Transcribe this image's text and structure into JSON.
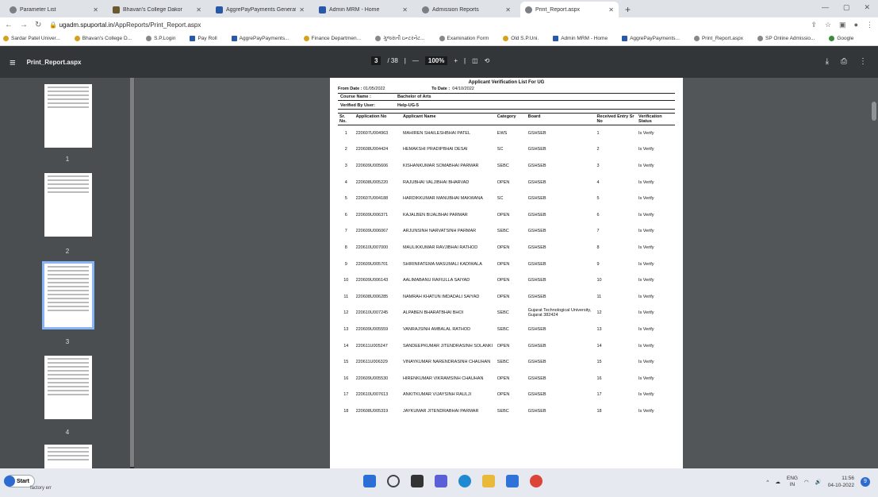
{
  "browser": {
    "tabs": [
      {
        "label": "Parameter List",
        "active": false
      },
      {
        "label": "Bhavan's College Dakor",
        "active": false
      },
      {
        "label": "AggrePayPayments Generate Cha",
        "active": false
      },
      {
        "label": "Admin MRM - Home",
        "active": false
      },
      {
        "label": "Admission Reports",
        "active": false
      },
      {
        "label": "Print_Report.aspx",
        "active": true
      }
    ],
    "new_tab": "+",
    "url_host": "ugadm.spuportal.in",
    "url_path": "/AppReports/Print_Report.aspx",
    "bookmarks": [
      "Sardar Patel Univer...",
      "Bhavan's College D...",
      "S.P.Login",
      "Pay Roll",
      "AggrePayPayments...",
      "Finance Departmen...",
      "ગુજરાતી ઇન્ટરનેટ...",
      "Examination Form",
      "Old S.P.Uni.",
      "Admin MRM - Home",
      "AggrePayPayments...",
      "Print_Report.aspx",
      "SP Online Admissio...",
      "Google"
    ]
  },
  "pdf": {
    "title": "Print_Report.aspx",
    "page_current": "3",
    "page_total": "/ 38",
    "zoom": "100%",
    "thumb_labels": [
      "1",
      "2",
      "3",
      "4"
    ]
  },
  "report": {
    "title": "Applicant Verification List For UG",
    "from_label": "From Date :",
    "from_date": "01/05/2022",
    "to_label": "To Date :",
    "to_date": "04/10/2022",
    "course_label": "Course Name :",
    "course": "Bachelor of Arts",
    "verified_label": "Verified By User:",
    "verified_user": "Help-UG-5",
    "columns": [
      "Sr. No.",
      "Application No",
      "Applicant Name",
      "Category",
      "Board",
      "Received Entry Sr No",
      "Verification Status"
    ],
    "rows": [
      [
        "1",
        "220607U004963",
        "MAHIREN SHAILESHBHAI PATEL",
        "EWS",
        "GSHSEB",
        "1",
        "Is Verify"
      ],
      [
        "2",
        "220608U004424",
        "HEMAKSHI PRADIPBHAI DESAI",
        "SC",
        "GSHSEB",
        "2",
        "Is Verify"
      ],
      [
        "3",
        "220609U005606",
        "KISHANKUMAR SOMABHAI PARMAR",
        "SEBC",
        "GSHSEB",
        "3",
        "Is Verify"
      ],
      [
        "4",
        "220608U005220",
        "RAJUBHAI VALJIBHAI BHARVAD",
        "OPEN",
        "GSHSEB",
        "4",
        "Is Verify"
      ],
      [
        "5",
        "220607U004188",
        "HARDIKKUMAR MANUBHAI MAKWANA",
        "SC",
        "GSHSEB",
        "5",
        "Is Verify"
      ],
      [
        "6",
        "220609U006371",
        "KAJALBEN BIJALBHAI PARMAR",
        "OPEN",
        "GSHSEB",
        "6",
        "Is Verify"
      ],
      [
        "7",
        "220609U006067",
        "ARJUNSINH NARVATSINH PARMAR",
        "SEBC",
        "GSHSEB",
        "7",
        "Is Verify"
      ],
      [
        "8",
        "220610U007000",
        "MAULIKKUMAR RAVJIBHAI RATHOD",
        "OPEN",
        "GSHSEB",
        "8",
        "Is Verify"
      ],
      [
        "9",
        "220609U005701",
        "SHIRINFATEMA MASUMALI KADIWALA",
        "OPEN",
        "GSHSEB",
        "9",
        "Is Verify"
      ],
      [
        "10",
        "220609U006143",
        "AALIMABANU RAFIULLA SAIYAD",
        "OPEN",
        "GSHSEB",
        "10",
        "Is Verify"
      ],
      [
        "11",
        "220608U006285",
        "NAMRAH KHATUN IMDADALI SAIYAD",
        "OPEN",
        "GSHSEB",
        "11",
        "Is Verify"
      ],
      [
        "12",
        "220610U007245",
        "ALPABEN BHARATBHAI BHOI",
        "SEBC",
        "Gujarat Technological University, Gujarat 382424",
        "12",
        "Is Verify"
      ],
      [
        "13",
        "220609U005559",
        "VANRAJSINH AMBALAL RATHOD",
        "SEBC",
        "GSHSEB",
        "13",
        "Is Verify"
      ],
      [
        "14",
        "220611U005247",
        "SANDEEPKUMAR JITENDRASINH SOLANKI",
        "OPEN",
        "GSHSEB",
        "14",
        "Is Verify"
      ],
      [
        "15",
        "220611U006329",
        "VINAYKUMAR NARENDRASINH CHAUHAN",
        "SEBC",
        "GSHSEB",
        "15",
        "Is Verify"
      ],
      [
        "16",
        "220609U005530",
        "HIRENKUMAR VIKRAMSINH CHAUHAN",
        "OPEN",
        "GSHSEB",
        "16",
        "Is Verify"
      ],
      [
        "17",
        "220610U007613",
        "ANKITKUMAR VIJAYSINH RAULJI",
        "OPEN",
        "GSHSEB",
        "17",
        "Is Verify"
      ],
      [
        "18",
        "220608U005319",
        "JAYKUMAR JITENDRABHAI PARMAR",
        "SEBC",
        "GSHSEB",
        "18",
        "Is Verify"
      ]
    ]
  },
  "taskbar": {
    "start_label": "Start",
    "start_sub": "factory err",
    "lang": "ENG",
    "region": "IN",
    "time": "11:56",
    "date": "04-10-2022",
    "notif_count": "9"
  }
}
